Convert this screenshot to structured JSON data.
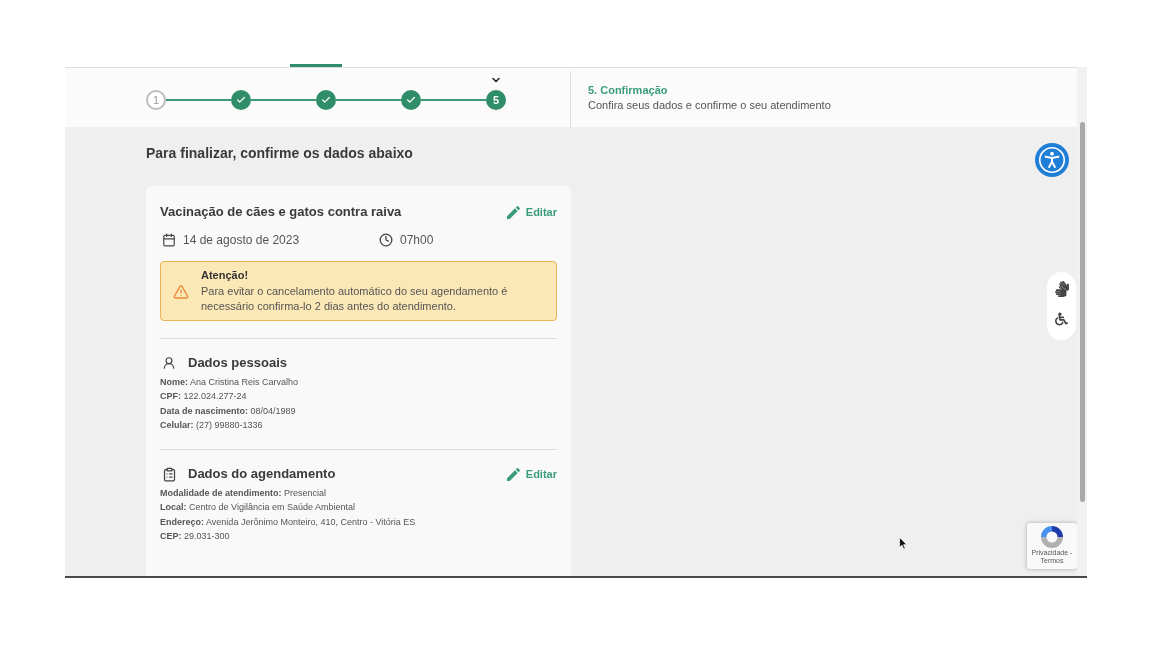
{
  "stepper": {
    "steps": [
      {
        "kind": "pending",
        "label": "1"
      },
      {
        "kind": "done"
      },
      {
        "kind": "done"
      },
      {
        "kind": "done"
      },
      {
        "kind": "current",
        "label": "5"
      }
    ]
  },
  "step_info": {
    "title": "5. Confirmação",
    "subtitle": "Confira seus dados e confirme o seu atendimento"
  },
  "heading": "Para finalizar, confirme os dados abaixo",
  "summary_card": {
    "service": "Vacinação de cães e gatos contra raiva",
    "edit_label": "Editar",
    "date": "14 de agosto de 2023",
    "time": "07h00",
    "alert": {
      "title": "Atenção!",
      "message": "Para evitar o cancelamento automático do seu agendamento é necessário confirma-lo 2 dias antes do atendimento."
    },
    "sections": [
      {
        "kind": "personal",
        "title": "Dados pessoais",
        "fields": [
          "**Nome:** Ana Cristina Reis Carvalho",
          "**CPF:** 122.024.277-24",
          "**Data de nascimento:** 08/04/1989",
          "**Celular:** (27) 99880-1336"
        ]
      },
      {
        "kind": "appointment",
        "title": "Dados do agendamento",
        "edit_label": "Editar",
        "fields": [
          "**Modalidade de atendimento:** Presencial",
          "**Local:** Centro de Vigilância em Saúde Ambiental",
          "**Endereço:** Avenida Jerônimo Monteiro, 410, Centro - Vitória ES",
          "**CEP:** 29.031-300"
        ]
      }
    ]
  },
  "recaptcha": {
    "links": "Privacidade - Termos"
  }
}
